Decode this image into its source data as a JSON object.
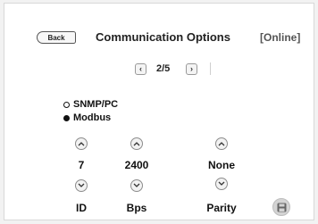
{
  "header": {
    "back_label": "Back",
    "title": "Communication Options",
    "status": "[Online]"
  },
  "pager": {
    "prev_icon": "chevron-left-icon",
    "text": "2/5",
    "next_icon": "chevron-right-icon"
  },
  "protocol": {
    "options": [
      {
        "label": "SNMP/PC",
        "selected": false
      },
      {
        "label": "Modbus",
        "selected": true
      }
    ]
  },
  "settings": {
    "id": {
      "value": "7",
      "label": "ID"
    },
    "baud": {
      "value": "2400",
      "label": "Bps"
    },
    "parity": {
      "value": "None",
      "label": "Parity"
    }
  },
  "icons": {
    "increase": "chevron-up-icon",
    "decrease": "chevron-down-icon",
    "save": "save-icon"
  },
  "colors": {
    "panel_bg": "#ffffff",
    "page_bg": "#f2f2f2",
    "text": "#111111",
    "status": "#555555"
  }
}
